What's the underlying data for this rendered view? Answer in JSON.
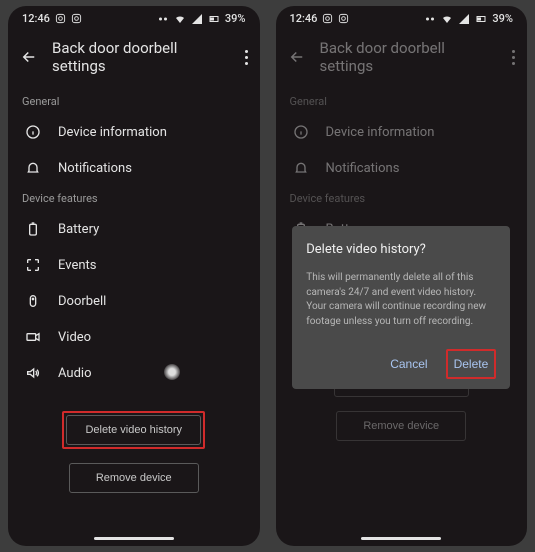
{
  "status": {
    "time": "12:46",
    "battery": "39%"
  },
  "header": {
    "title": "Back door doorbell settings"
  },
  "sections": {
    "general_label": "General",
    "features_label": "Device features"
  },
  "rows": {
    "deviceinfo": "Device information",
    "notifications": "Notifications",
    "battery": "Battery",
    "events": "Events",
    "doorbell": "Doorbell",
    "video": "Video",
    "audio": "Audio"
  },
  "actions": {
    "delete_history": "Delete video history",
    "remove_device": "Remove device"
  },
  "dialog": {
    "title": "Delete video history?",
    "body": "This will permanently delete all of this camera's 24/7 and event video history. Your camera will continue recording new footage unless you turn off recording.",
    "cancel": "Cancel",
    "delete": "Delete"
  }
}
